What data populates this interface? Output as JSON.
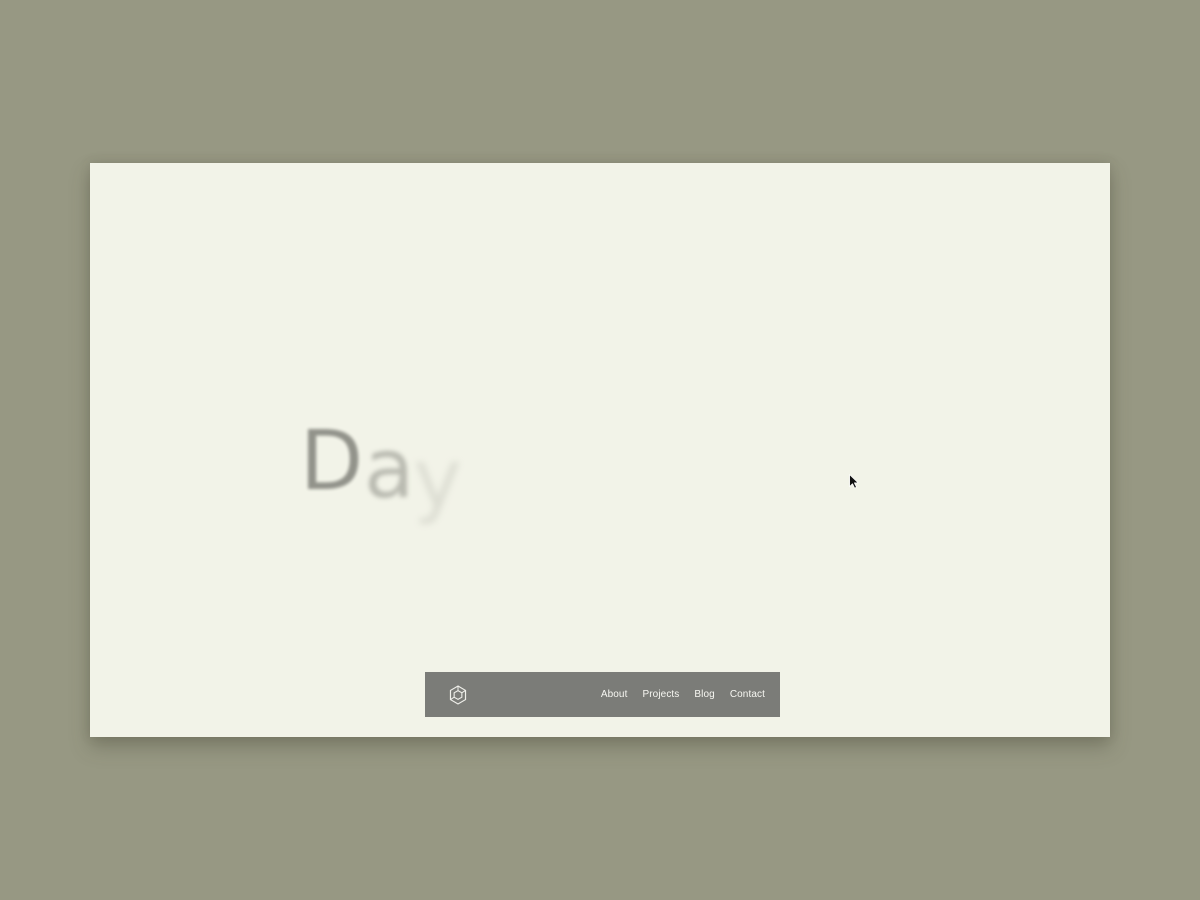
{
  "hero": {
    "letters": [
      "D",
      "a",
      "y"
    ]
  },
  "navbar": {
    "logo_icon": "hexagon-logo-icon",
    "links": [
      {
        "label": "About"
      },
      {
        "label": "Projects"
      },
      {
        "label": "Blog"
      },
      {
        "label": "Contact"
      }
    ]
  },
  "cursor": {
    "icon": "mouse-pointer-icon"
  },
  "colors": {
    "backdrop": "#979883",
    "page_background": "#f2f3e8",
    "navbar_background": "#7b7c78",
    "navbar_text": "#f7f7f2",
    "hero_text": "#8d8e86"
  }
}
